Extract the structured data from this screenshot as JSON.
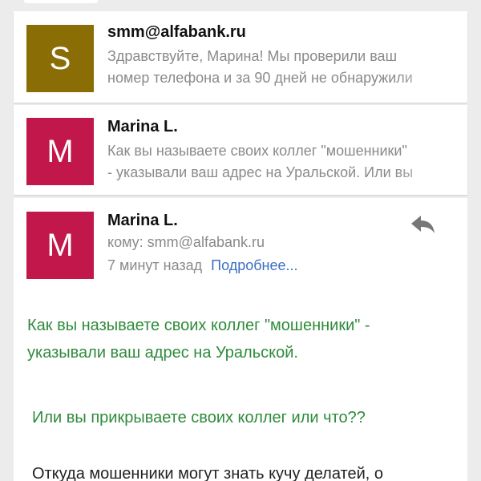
{
  "colors": {
    "avatar_s": "#8a6d05",
    "avatar_m": "#c2174a",
    "link": "#3b6fc2",
    "body_green": "#2e8b3a"
  },
  "threads": [
    {
      "avatar_letter": "S",
      "sender": "smm@alfabank.ru",
      "snippet_lines": [
        "Здравствуйте, Марина! Мы проверили ваш",
        "номер телефона и за 90 дней не обнаружили"
      ]
    },
    {
      "avatar_letter": "M",
      "sender": "Marina L.",
      "snippet_lines": [
        "Как вы называете своих коллег \"мошенники\"",
        "- указывали ваш адрес на Уральской. Или вы"
      ]
    }
  ],
  "open_message": {
    "avatar_letter": "M",
    "sender": "Marina L.",
    "to_line": "кому: smm@alfabank.ru",
    "time": "7 минут назад",
    "details_link": "Подробнее...",
    "reply_icon": "reply-icon",
    "body_lines": [
      "Как вы называете своих коллег \"мошенники\" -",
      "указывали ваш адрес на Уральской.",
      "Или вы прикрываете своих коллег или что??",
      "Откуда мошенники могут знать кучу делатей, о"
    ]
  }
}
